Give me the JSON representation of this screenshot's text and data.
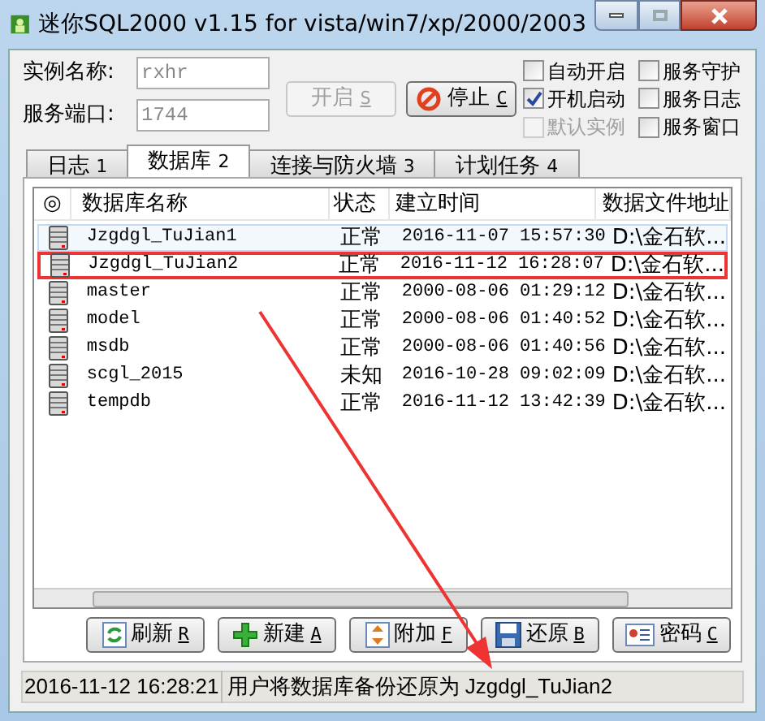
{
  "window": {
    "title": "迷你SQL2000 v1.15 for vista/win7/xp/2000/2003"
  },
  "instance": {
    "name_label": "实例名称:",
    "name_value": "rxhr",
    "port_label": "服务端口:",
    "port_value": "1744"
  },
  "service_buttons": [
    {
      "label": "开启",
      "key": "S",
      "disabled": true,
      "kind": "start"
    },
    {
      "label": "停止",
      "key": "C",
      "disabled": false,
      "kind": "stop"
    }
  ],
  "options": [
    {
      "label": "自动开启",
      "checked": false,
      "disabled": false
    },
    {
      "label": "服务守护",
      "checked": false,
      "disabled": false
    },
    {
      "label": "开机启动",
      "checked": true,
      "disabled": false
    },
    {
      "label": "服务日志",
      "checked": false,
      "disabled": false
    },
    {
      "label": "默认实例",
      "checked": false,
      "disabled": true
    },
    {
      "label": "服务窗口",
      "checked": false,
      "disabled": false
    }
  ],
  "tabs": [
    {
      "label": "日志",
      "key": "1",
      "selected": false
    },
    {
      "label": "数据库",
      "key": "2",
      "selected": true
    },
    {
      "label": "连接与防火墙",
      "key": "3",
      "selected": false
    },
    {
      "label": "计划任务",
      "key": "4",
      "selected": false
    }
  ],
  "table": {
    "columns": [
      "◎",
      "数据库名称",
      "状态",
      "建立时间",
      "数据文件地址"
    ],
    "rows": [
      {
        "name": "Jzgdgl_TuJian1",
        "status": "正常",
        "created": "2016-11-07 15:57:30",
        "path": "D:\\金石软...",
        "selected": true,
        "highlighted": false
      },
      {
        "name": "Jzgdgl_TuJian2",
        "status": "正常",
        "created": "2016-11-12 16:28:07",
        "path": "D:\\金石软...",
        "selected": false,
        "highlighted": true
      },
      {
        "name": "master",
        "status": "正常",
        "created": "2000-08-06 01:29:12",
        "path": "D:\\金石软...",
        "selected": false,
        "highlighted": false
      },
      {
        "name": "model",
        "status": "正常",
        "created": "2000-08-06 01:40:52",
        "path": "D:\\金石软...",
        "selected": false,
        "highlighted": false
      },
      {
        "name": "msdb",
        "status": "正常",
        "created": "2000-08-06 01:40:56",
        "path": "D:\\金石软...",
        "selected": false,
        "highlighted": false
      },
      {
        "name": "scgl_2015",
        "status": "未知",
        "created": "2016-10-28 09:02:09",
        "path": "D:\\金石软...",
        "selected": false,
        "highlighted": false
      },
      {
        "name": "tempdb",
        "status": "正常",
        "created": "2016-11-12 13:42:39",
        "path": "D:\\金石软...",
        "selected": false,
        "highlighted": false
      }
    ]
  },
  "actions": [
    {
      "label": "刷新",
      "key": "R",
      "kind": "refresh"
    },
    {
      "label": "新建",
      "key": "A",
      "kind": "new"
    },
    {
      "label": "附加",
      "key": "F",
      "kind": "attach"
    },
    {
      "label": "还原",
      "key": "B",
      "kind": "restore"
    },
    {
      "label": "密码",
      "key": "C",
      "kind": "password"
    }
  ],
  "status_bar": {
    "time": "2016-11-12 16:28:21",
    "message": "用户将数据库备份还原为 Jzgdgl_TuJian2"
  }
}
